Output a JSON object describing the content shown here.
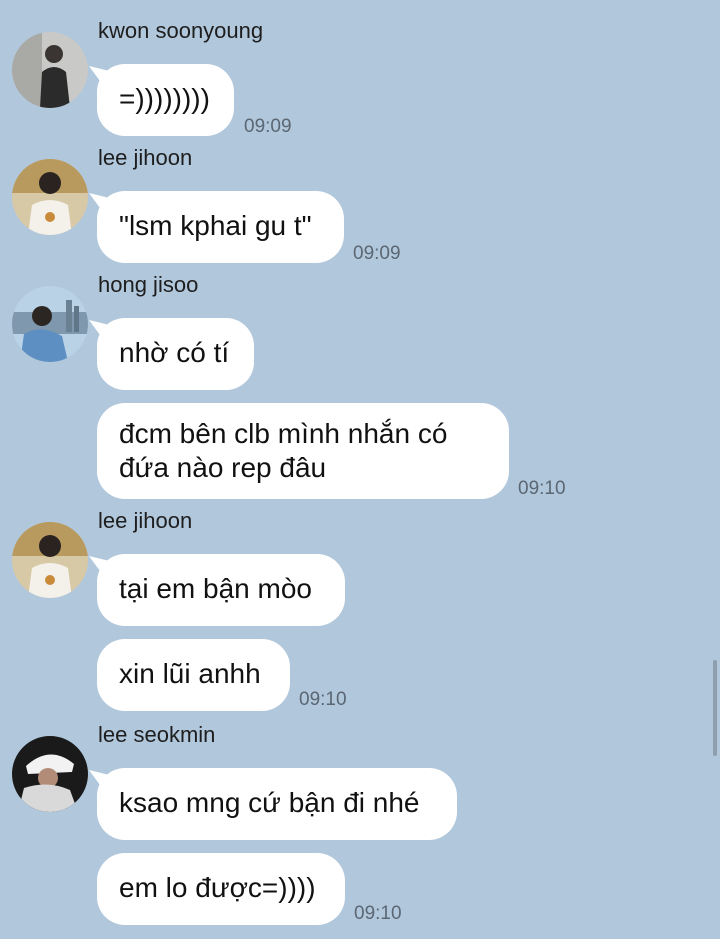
{
  "messages": [
    {
      "sender": "kwon soonyoung",
      "avatar": "person-photo-grey",
      "bubbles": [
        "=))))))))"
      ],
      "time": "09:09"
    },
    {
      "sender": "lee jihoon",
      "avatar": "person-photo-white-shirt",
      "bubbles": [
        "\"lsm kphai gu t\""
      ],
      "time": "09:09"
    },
    {
      "sender": "hong jisoo",
      "avatar": "person-photo-city-skyline",
      "bubbles": [
        "nhờ có tí",
        "đcm bên clb mình nhắn có",
        "đứa nào rep đâu"
      ],
      "time": "09:10"
    },
    {
      "sender": "lee jihoon",
      "avatar": "person-photo-white-shirt",
      "bubbles": [
        "tại em bận mòo",
        "xin lũi anhh"
      ],
      "time": "09:10"
    },
    {
      "sender": "lee seokmin",
      "avatar": "person-photo-cap",
      "bubbles": [
        "ksao mng cứ bận đi nhé",
        "em lo được=))))"
      ],
      "time": "09:10"
    }
  ]
}
